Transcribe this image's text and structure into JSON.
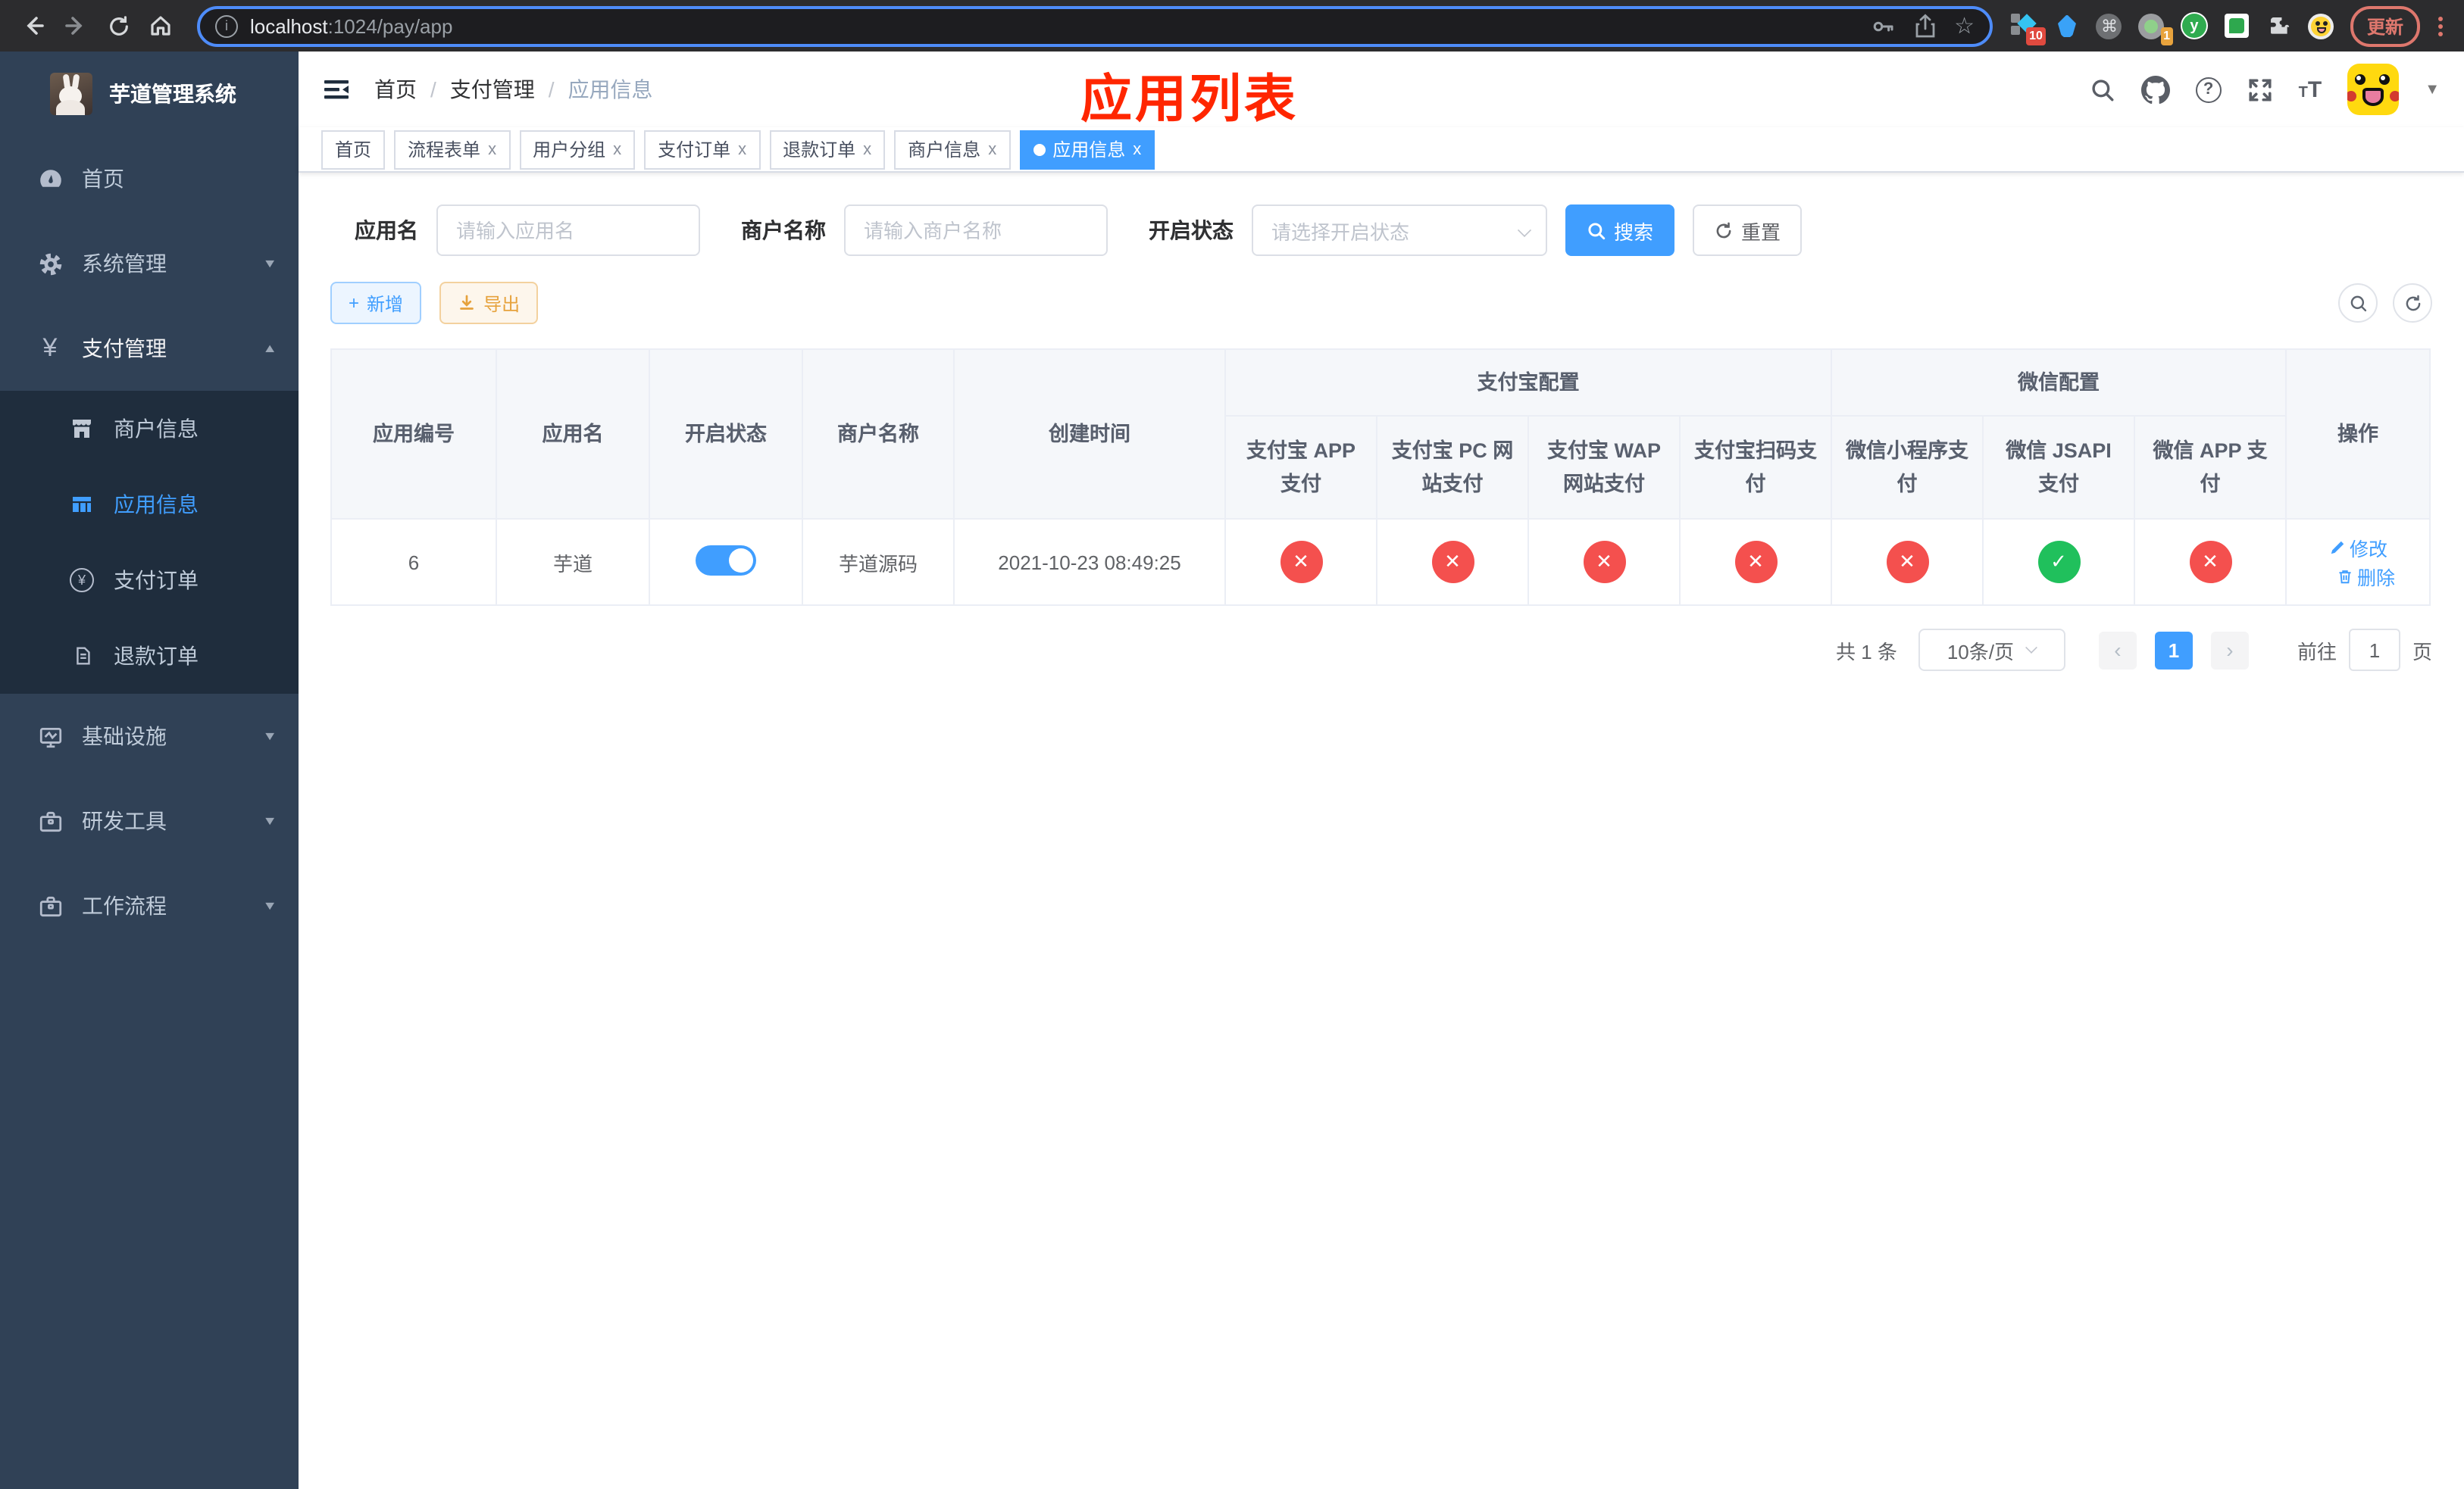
{
  "colors": {
    "accent": "#409eff",
    "danger": "#f4504e",
    "success": "#20c05c",
    "warning": "#e6a23c",
    "annotation": "#ff2600",
    "sidebar_bg": "#304156",
    "submenu_bg": "#1f2d3d"
  },
  "browser": {
    "url_host": "localhost",
    "url_rest": ":1024/pay/app",
    "ext_badge_sketch": "10",
    "ext_badge_record": "1",
    "ext_y_letter": "y",
    "command_glyph": "⌘",
    "star_glyph": "☆",
    "info_glyph": "i",
    "update_label": "更新"
  },
  "sidebar": {
    "title": "芋道管理系统",
    "items": [
      {
        "label": "首页"
      },
      {
        "label": "系统管理"
      },
      {
        "label": "支付管理"
      },
      {
        "label": "商户信息"
      },
      {
        "label": "应用信息"
      },
      {
        "label": "支付订单"
      },
      {
        "label": "退款订单"
      },
      {
        "label": "基础设施"
      },
      {
        "label": "研发工具"
      },
      {
        "label": "工作流程"
      }
    ],
    "yen_glyph": "¥"
  },
  "header": {
    "breadcrumb": [
      "首页",
      "支付管理",
      "应用信息"
    ],
    "annotation": "应用列表",
    "question_glyph": "?",
    "t_small": "T",
    "t_big": "T"
  },
  "ui": {
    "sep": "/",
    "close_glyph": "x",
    "prev_glyph": "‹",
    "next_glyph": "›",
    "plus_glyph": "+"
  },
  "tabs": [
    {
      "label": "首页",
      "closable": false,
      "active": false
    },
    {
      "label": "流程表单",
      "closable": true,
      "active": false
    },
    {
      "label": "用户分组",
      "closable": true,
      "active": false
    },
    {
      "label": "支付订单",
      "closable": true,
      "active": false
    },
    {
      "label": "退款订单",
      "closable": true,
      "active": false
    },
    {
      "label": "商户信息",
      "closable": true,
      "active": false
    },
    {
      "label": "应用信息",
      "closable": true,
      "active": true
    }
  ],
  "filters": {
    "app_name_label": "应用名",
    "app_name_placeholder": "请输入应用名",
    "merchant_label": "商户名称",
    "merchant_placeholder": "请输入商户名称",
    "status_label": "开启状态",
    "status_placeholder": "请选择开启状态",
    "search_label": "搜索",
    "reset_label": "重置"
  },
  "toolbar": {
    "add_label": "新增",
    "export_label": "导出"
  },
  "table": {
    "columns": {
      "id": "应用编号",
      "name": "应用名",
      "status": "开启状态",
      "merchant": "商户名称",
      "created": "创建时间",
      "alipay_group": "支付宝配置",
      "wechat_group": "微信配置",
      "alipay_app": "支付宝 APP 支付",
      "alipay_pc": "支付宝 PC 网站支付",
      "alipay_wap": "支付宝 WAP 网站支付",
      "alipay_qr": "支付宝扫码支付",
      "wx_lite": "微信小程序支付",
      "wx_jsapi": "微信 JSAPI 支付",
      "wx_app": "微信 APP 支付",
      "op": "操作"
    },
    "row": {
      "id": "6",
      "name": "芋道",
      "enabled": true,
      "merchant": "芋道源码",
      "created": "2021-10-23 08:49:25",
      "configs": [
        {
          "name": "alipay-app-pay",
          "state": "off",
          "glyph": "✕"
        },
        {
          "name": "alipay-pc-pay",
          "state": "off",
          "glyph": "✕"
        },
        {
          "name": "alipay-wap-pay",
          "state": "off",
          "glyph": "✕"
        },
        {
          "name": "alipay-qr-pay",
          "state": "off",
          "glyph": "✕"
        },
        {
          "name": "wechat-lite-pay",
          "state": "off",
          "glyph": "✕"
        },
        {
          "name": "wechat-jsapi-pay",
          "state": "on",
          "glyph": "✓"
        },
        {
          "name": "wechat-app-pay",
          "state": "off",
          "glyph": "✕"
        }
      ],
      "edit_label": "修改",
      "delete_label": "删除"
    }
  },
  "pagination": {
    "total": "共 1 条",
    "per_page": "10条/页",
    "page": "1",
    "goto_label": "前往",
    "goto_value": "1",
    "page_unit": "页"
  }
}
